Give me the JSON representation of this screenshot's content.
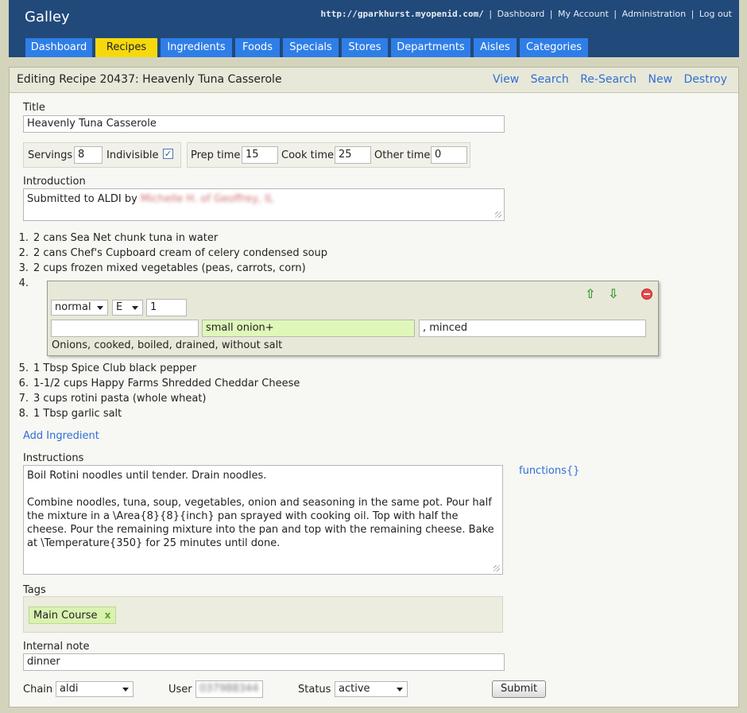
{
  "header": {
    "app_title": "Galley",
    "openid": "http://gparkhurst.myopenid.com/",
    "links": [
      "Dashboard",
      "My Account",
      "Administration",
      "Log out"
    ]
  },
  "tabs": [
    "Dashboard",
    "Recipes",
    "Ingredients",
    "Foods",
    "Specials",
    "Stores",
    "Departments",
    "Aisles",
    "Categories"
  ],
  "active_tab": "Recipes",
  "page": {
    "title": "Editing Recipe 20437: Heavenly Tuna Casserole",
    "actions": [
      "View",
      "Search",
      "Re-Search",
      "New",
      "Destroy"
    ]
  },
  "form": {
    "title_label": "Title",
    "title_value": "Heavenly Tuna Casserole",
    "servings_label": "Servings",
    "servings_value": "8",
    "indivisible_label": "Indivisible",
    "indivisible_checked": true,
    "prep_label": "Prep time",
    "prep_value": "15",
    "cook_label": "Cook time",
    "cook_value": "25",
    "other_label": "Other time",
    "other_value": "0",
    "intro_label": "Introduction",
    "intro_text": "Submitted to ALDI by",
    "intro_redacted": "Michelle H. of Geoffrey, IL"
  },
  "ingredients": [
    {
      "num": "1.",
      "text": "2 cans Sea Net chunk tuna in water"
    },
    {
      "num": "2.",
      "text": "2 cans Chef's Cupboard cream of celery condensed soup"
    },
    {
      "num": "3.",
      "text": "2 cups frozen mixed vegetables (peas, carrots, corn)"
    },
    {
      "num": "4.",
      "text": ""
    },
    {
      "num": "5.",
      "text": "1 Tbsp Spice Club black pepper"
    },
    {
      "num": "6.",
      "text": "1-1/2 cups Happy Farms Shredded Cheddar Cheese"
    },
    {
      "num": "7.",
      "text": "3 cups rotini pasta (whole wheat)"
    },
    {
      "num": "8.",
      "text": "1 Tbsp garlic salt"
    }
  ],
  "editing_ingredient": {
    "type_select": "normal",
    "unit_select": "E",
    "quantity": "1",
    "prefix": "",
    "food": "small onion+",
    "suffix": ", minced",
    "match": "Onions, cooked, boiled, drained, without salt",
    "food_bg": "#dff7b9"
  },
  "add_ingredient": "Add Ingredient",
  "instructions_label": "Instructions",
  "instructions_para1": "Boil Rotini noodles until tender. Drain noodles.",
  "instructions_para2": "Combine noodles, tuna, soup, vegetables, onion and seasoning in the same pot. Pour half the mixture in a \\Area{8}{8}{inch} pan sprayed with cooking oil. Top with half the cheese. Pour the remaining mixture into the pan and top with the remaining cheese. Bake at \\Temperature{350} for 25 minutes until done.",
  "functions_link": "functions{}",
  "tags_label": "Tags",
  "tags": [
    "Main Course"
  ],
  "note_label": "Internal note",
  "note_value": "dinner",
  "chain_label": "Chain",
  "chain_value": "aldi",
  "user_label": "User",
  "user_redacted": "037988344",
  "status_label": "Status",
  "status_value": "active",
  "submit_label": "Submit",
  "colors": {
    "header_bg": "#21497a",
    "tab_bg": "#2f7ee8",
    "tab_active_bg": "#f5d90e",
    "link": "#2f6fd6",
    "page_bg": "#d4d4bc"
  }
}
